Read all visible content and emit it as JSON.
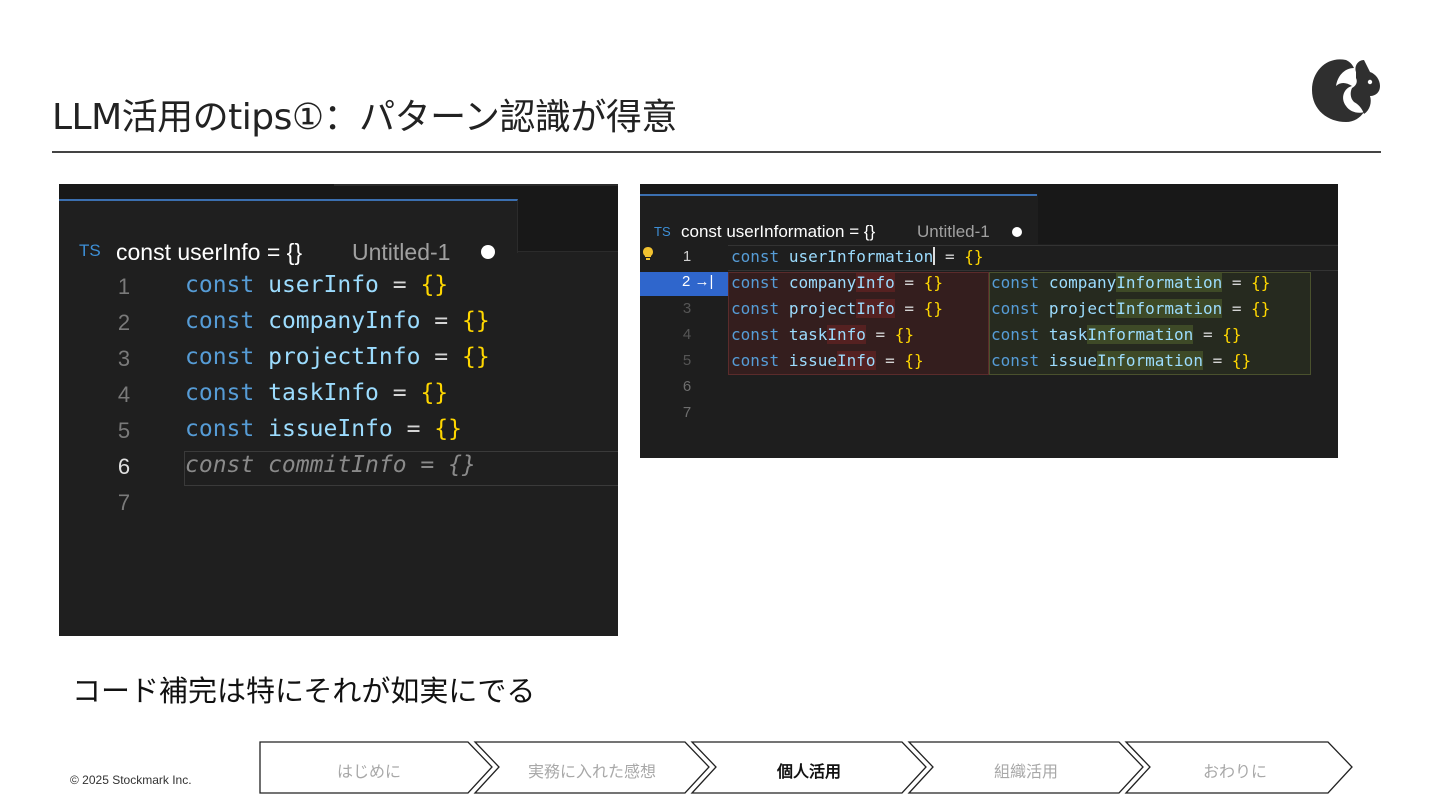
{
  "slide": {
    "title": "LLM活用のtips①：パターン認識が得意",
    "subtitle": "コード補完は特にそれが如実にでる",
    "copyright": "© 2025 Stockmark Inc."
  },
  "editor_left": {
    "tab_lang": "TS",
    "tab_title": "const userInfo = {}",
    "tab_file": "Untitled-1",
    "lines": [
      {
        "num": "1",
        "kw": "const",
        "id": "userInfo",
        "op": " = ",
        "br": "{}"
      },
      {
        "num": "2",
        "kw": "const",
        "id": "companyInfo",
        "op": " = ",
        "br": "{}"
      },
      {
        "num": "3",
        "kw": "const",
        "id": "projectInfo",
        "op": " = ",
        "br": "{}"
      },
      {
        "num": "4",
        "kw": "const",
        "id": "taskInfo",
        "op": " = ",
        "br": "{}"
      },
      {
        "num": "5",
        "kw": "const",
        "id": "issueInfo",
        "op": " = ",
        "br": "{}"
      },
      {
        "num": "6",
        "ghost": "const commitInfo = {}"
      },
      {
        "num": "7"
      }
    ]
  },
  "editor_right": {
    "tab_lang": "TS",
    "tab_title": "const userInformation = {}",
    "tab_file": "Untitled-1",
    "line1": {
      "num": "1",
      "kw": "const",
      "id": "userInformation",
      "op": " = ",
      "br": "{}"
    },
    "accept_badge": "2 →|",
    "old_lines": [
      {
        "kw": "const",
        "id_a": "company",
        "id_b": "Info",
        "op": " = ",
        "br": "{}"
      },
      {
        "kw": "const",
        "id_a": "project",
        "id_b": "Info",
        "op": " = ",
        "br": "{}"
      },
      {
        "kw": "const",
        "id_a": "task",
        "id_b": "Info",
        "op": " = ",
        "br": "{}"
      },
      {
        "kw": "const",
        "id_a": "issue",
        "id_b": "Info",
        "op": " = ",
        "br": "{}"
      }
    ],
    "new_lines": [
      {
        "kw": "const",
        "id_a": "company",
        "id_b": "Information",
        "op": " = ",
        "br": "{}"
      },
      {
        "kw": "const",
        "id_a": "project",
        "id_b": "Information",
        "op": " = ",
        "br": "{}"
      },
      {
        "kw": "const",
        "id_a": "task",
        "id_b": "Information",
        "op": " = ",
        "br": "{}"
      },
      {
        "kw": "const",
        "id_a": "issue",
        "id_b": "Information",
        "op": " = ",
        "br": "{}"
      }
    ],
    "line_nums": [
      "3",
      "4",
      "5",
      "6",
      "7"
    ]
  },
  "nav": {
    "items": [
      "はじめに",
      "実務に入れた感想",
      "個人活用",
      "組織活用",
      "おわりに"
    ],
    "active_index": 2
  },
  "colors": {
    "keyword": "#569cd6",
    "identifier": "#9cdcfe",
    "brace": "#ffd700",
    "editor_bg": "#1f1f1f",
    "accept_badge": "#2f66cc"
  }
}
